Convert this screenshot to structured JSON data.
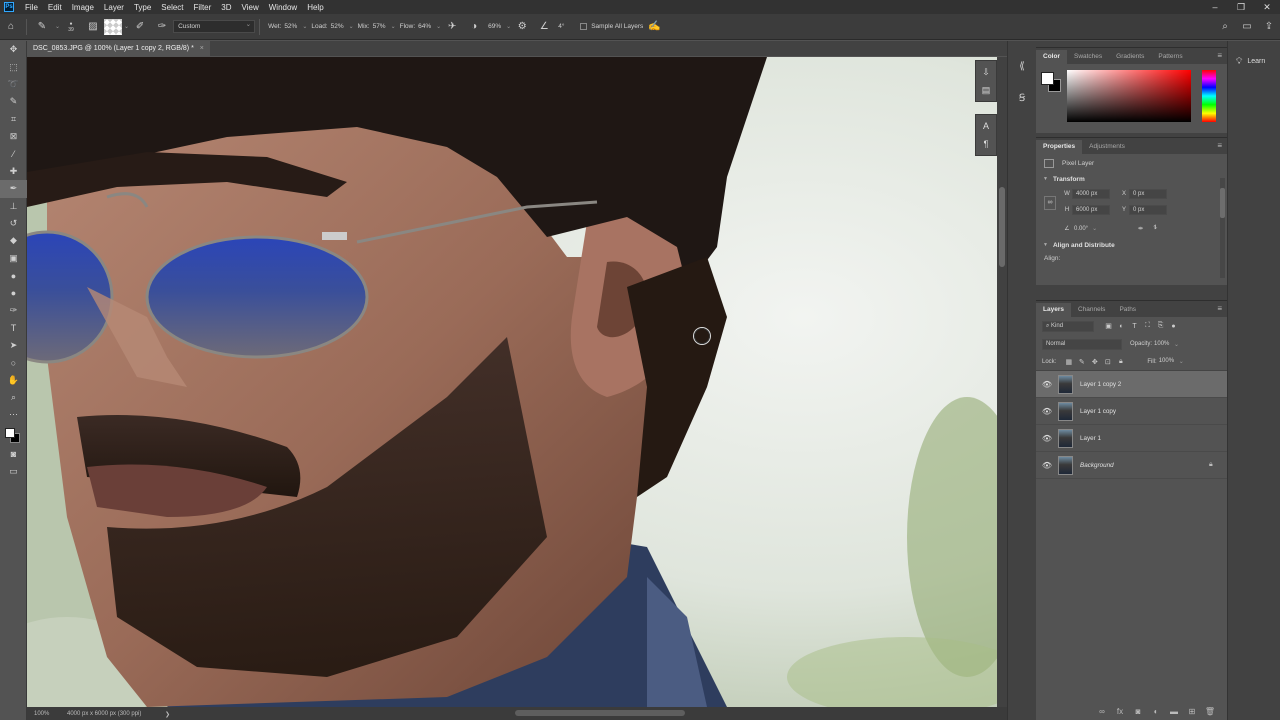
{
  "menubar": {
    "logo": "Ps",
    "items": [
      "File",
      "Edit",
      "Image",
      "Layer",
      "Type",
      "Select",
      "Filter",
      "3D",
      "View",
      "Window",
      "Help"
    ],
    "window_controls": [
      "–",
      "❐",
      "✕"
    ]
  },
  "options": {
    "brush_size": "39",
    "preset": "Custom",
    "wet_label": "Wet:",
    "wet_value": "52%",
    "load_label": "Load:",
    "load_value": "52%",
    "mix_label": "Mix:",
    "mix_value": "57%",
    "flow_label": "Flow:",
    "flow_value": "64%",
    "smoothing_value": "69%",
    "angle_value": "4°",
    "sample_all_layers": "Sample All Layers"
  },
  "document": {
    "tab_title": "DSC_0853.JPG @ 100% (Layer 1 copy 2, RGB/8) *",
    "close": "×"
  },
  "status": {
    "zoom": "100%",
    "doc_info": "4000 px x 6000 px (300 ppi)",
    "arrow": "❯"
  },
  "panels": {
    "color_tabs": [
      "Color",
      "Swatches",
      "Gradients",
      "Patterns"
    ],
    "props_tabs": [
      "Properties",
      "Adjustments"
    ],
    "pixel_layer": "Pixel Layer",
    "transform_title": "Transform",
    "w_label": "W",
    "w_value": "4000 px",
    "h_label": "H",
    "h_value": "6000 px",
    "x_label": "X",
    "x_value": "0 px",
    "y_label": "Y",
    "y_value": "0 px",
    "angle_value": "0.00°",
    "align_title": "Align and Distribute",
    "align_label": "Align:",
    "layers_tabs": [
      "Layers",
      "Channels",
      "Paths"
    ],
    "kind_value": "Kind",
    "blend_mode": "Normal",
    "opacity_label": "Opacity:",
    "opacity_value": "100%",
    "lock_label": "Lock:",
    "fill_label": "Fill:",
    "fill_value": "100%",
    "layers": [
      {
        "name": "Layer 1 copy 2",
        "selected": true
      },
      {
        "name": "Layer 1 copy",
        "selected": false
      },
      {
        "name": "Layer 1",
        "selected": false
      },
      {
        "name": "Background",
        "selected": false
      }
    ],
    "learn": "Learn"
  },
  "colors": {
    "foreground": "#ffffff",
    "background": "#000000",
    "ui_dark": "#535353"
  }
}
